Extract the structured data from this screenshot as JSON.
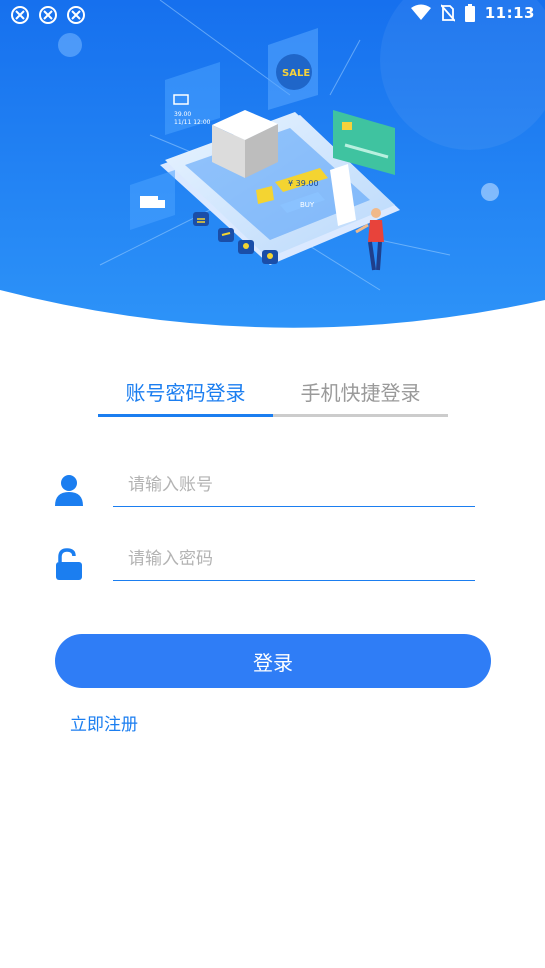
{
  "status_bar": {
    "time": "11:13",
    "left_icons": [
      "app-notification-icon",
      "app-notification-icon",
      "app-notification-icon"
    ],
    "right_icons": [
      "wifi-icon",
      "no-sim-icon",
      "battery-icon"
    ]
  },
  "banner": {
    "sale_text": "SALE",
    "price_text": "¥ 39.00",
    "pay_text": "BUY",
    "date_text": "11/11 12:00",
    "amount_text": "39.00"
  },
  "tabs": [
    {
      "label": "账号密码登录",
      "active": true
    },
    {
      "label": "手机快捷登录",
      "active": false
    }
  ],
  "form": {
    "account_placeholder": "请输入账号",
    "password_placeholder": "请输入密码",
    "login_label": "登录",
    "register_label": "立即注册"
  },
  "colors": {
    "accent": "#1b7ef0",
    "button": "#2f7df6",
    "hero_top": "#1a74ee",
    "hero_bottom": "#2a8cf7"
  }
}
